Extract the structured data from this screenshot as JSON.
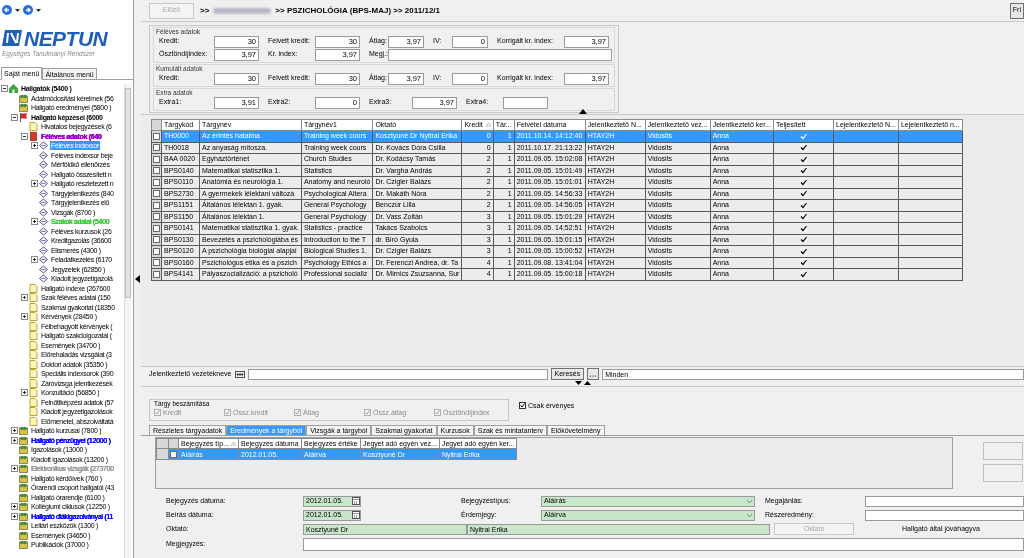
{
  "logo": {
    "name": "NEPTUN",
    "subtitle": "Egységes Tanulmányi Rendszer"
  },
  "menu_tabs": [
    {
      "label": "Saját menü",
      "selected": true
    },
    {
      "label": "Általános menü",
      "selected": false
    }
  ],
  "tree": [
    {
      "label": "Hallgatók (5400 )",
      "kind": "home",
      "bold": true,
      "expanded": true,
      "selected": false,
      "children": [
        {
          "label": "Adatmódosítási kérelmek (56",
          "kind": "group",
          "selected": false
        },
        {
          "label": "Hallgató eredményei (5800 )",
          "kind": "group",
          "selected": false
        },
        {
          "label": "Hallgató képzései (6000",
          "kind": "flag",
          "bold": true,
          "expanded": true,
          "selected": false,
          "children": [
            {
              "label": "Hivatalos bejegyzések (6",
              "kind": "page",
              "selected": false
            },
            {
              "label": "Féléves adatok (640",
              "kind": "book",
              "bold": true,
              "color": "#9900cc",
              "expanded": true,
              "selected": false,
              "children": [
                {
                  "label": "Féléves indexsor",
                  "kind": "form",
                  "expanded": false,
                  "selected": true
                },
                {
                  "label": "Féléves indexsor beje",
                  "kind": "form",
                  "selected": false
                },
                {
                  "label": "Mérföldkő ellenőrzés",
                  "kind": "form",
                  "selected": false
                },
                {
                  "label": "Hallgató összesített n",
                  "kind": "form",
                  "selected": false
                },
                {
                  "label": "Hallgató részletezett n",
                  "kind": "form",
                  "expanded": false,
                  "selected": false
                },
                {
                  "label": "Tárgyjelentkezés (840",
                  "kind": "form",
                  "selected": false
                },
                {
                  "label": "Tárgyjelentkezés elő",
                  "kind": "form",
                  "selected": false
                },
                {
                  "label": "Vizsgák (8700 )",
                  "kind": "form",
                  "selected": false
                },
                {
                  "label": "Szakok adatai (5400",
                  "kind": "form",
                  "color": "#33cc33",
                  "expanded": false,
                  "selected": false
                },
                {
                  "label": "Féléves kurzusok (26",
                  "kind": "form",
                  "selected": false
                },
                {
                  "label": "Kreditgazolás (36600",
                  "kind": "form",
                  "selected": false
                },
                {
                  "label": "Elismerés (4300 )",
                  "kind": "form",
                  "selected": false
                },
                {
                  "label": "Feladatkezelés (6170",
                  "kind": "form",
                  "expanded": false,
                  "selected": false
                },
                {
                  "label": "Jegyzetek (62850 )",
                  "kind": "form",
                  "selected": false
                },
                {
                  "label": "Kiadott jegyzetigazolá",
                  "kind": "form",
                  "selected": false
                }
              ]
            },
            {
              "label": "Hallgató indexe (267600",
              "kind": "page",
              "selected": false
            },
            {
              "label": "Szak féléves adatai (150",
              "kind": "page",
              "expanded": false,
              "selected": false
            },
            {
              "label": "Szakmai gyakorlat (18350",
              "kind": "page",
              "selected": false
            },
            {
              "label": "Kérvények (28450 )",
              "kind": "page",
              "expanded": false,
              "selected": false
            },
            {
              "label": "Félbehagyott kérvények (",
              "kind": "page",
              "selected": false
            },
            {
              "label": "Hallgató szakdolgozatai (",
              "kind": "page",
              "selected": false
            },
            {
              "label": "Események (34700 )",
              "kind": "page",
              "selected": false
            },
            {
              "label": "Előrehaladás vizsgálat (3",
              "kind": "page",
              "selected": false
            },
            {
              "label": "Doktori adatok (35350 )",
              "kind": "page",
              "selected": false
            },
            {
              "label": "Speciális indexsorok (390",
              "kind": "page",
              "selected": false
            },
            {
              "label": "Záróvizsga jelentkezések",
              "kind": "page",
              "selected": false
            },
            {
              "label": "Konzultáció (56850 )",
              "kind": "page",
              "expanded": false,
              "selected": false
            },
            {
              "label": "Felnőttképzési adatok (57",
              "kind": "page",
              "selected": false
            },
            {
              "label": "Kiadott jegyzetigazolások",
              "kind": "page",
              "selected": false
            },
            {
              "label": "Előmenetel, abszolváltatá",
              "kind": "page",
              "selected": false
            }
          ]
        },
        {
          "label": "Hallgató kurzusai (7800 )",
          "kind": "group",
          "expanded": false,
          "selected": false
        },
        {
          "label": "Hallgató pénzügyei (12000 )",
          "kind": "group",
          "color": "#0000ff",
          "expanded": false,
          "selected": false
        },
        {
          "label": "Igazolások (13000 )",
          "kind": "group",
          "selected": false
        },
        {
          "label": "Kiadott igazolások (13200 )",
          "kind": "group",
          "selected": false
        },
        {
          "label": "Elektronikus vizsgák (273700",
          "kind": "group",
          "color": "#999999",
          "expanded": false,
          "selected": false
        },
        {
          "label": "Hallgató kérdőívek (760 )",
          "kind": "group",
          "selected": false
        },
        {
          "label": "Órarendi csoport hallgatói (43",
          "kind": "group",
          "selected": false
        },
        {
          "label": "Hallgató órarendje (6100 )",
          "kind": "group",
          "selected": false
        },
        {
          "label": "Kollégiumi ciklusok (12250 )",
          "kind": "group",
          "expanded": false,
          "selected": false
        },
        {
          "label": "Hallgató diákigazolványai (11",
          "kind": "group",
          "color": "#0000ff",
          "expanded": false,
          "selected": false
        },
        {
          "label": "Leltári eszközök (1300 )",
          "kind": "group",
          "selected": false
        },
        {
          "label": "Események (34650 )",
          "kind": "group",
          "selected": false
        },
        {
          "label": "Publikációk (37000 )",
          "kind": "group",
          "selected": false
        }
      ]
    }
  ],
  "header": {
    "back_button": {
      "label": "Előző",
      "disabled": true
    },
    "path_start": ">>",
    "path": ">> PSZICHOLÓGIA (BPS-MAJ) >> 2011/12/1",
    "corner_button": "Fri"
  },
  "summary": [
    {
      "legend": "Féléves adatok",
      "rows": [
        {
          "kind": "standard",
          "fields": [
            {
              "label": "Kredit:",
              "value": "30"
            },
            {
              "label": "Felvett kredit:",
              "value": "30"
            },
            {
              "label": "Átlag:",
              "value": "3,97"
            },
            {
              "label": "IV:",
              "value": "0"
            },
            {
              "label": "Korrigált kr. index:",
              "value": "3,97"
            }
          ]
        },
        {
          "kind": "notes",
          "fields": [
            {
              "label": "Ösztöndíjindex:",
              "value": "3,97"
            },
            {
              "label": "Kr. index:",
              "value": "3,97"
            },
            {
              "label": "Megj.:"
            }
          ]
        }
      ]
    },
    {
      "legend": "Kumulált adatok",
      "rows": [
        {
          "kind": "standard",
          "fields": [
            {
              "label": "Kredit:",
              "value": "30"
            },
            {
              "label": "Felvett kredit:",
              "value": "30"
            },
            {
              "label": "Átlag:",
              "value": "3,97"
            },
            {
              "label": "IV:",
              "value": "0"
            },
            {
              "label": "Korrigált kr. index:",
              "value": "3,97"
            }
          ]
        }
      ]
    },
    {
      "legend": "Extra adatok",
      "rows": [
        {
          "kind": "extra",
          "fields": [
            {
              "label": "Extra1:",
              "value": "3,91"
            },
            {
              "label": "Extra2:",
              "value": "0"
            },
            {
              "label": "Extra3:",
              "value": "3,97"
            },
            {
              "label": "Extra4:"
            }
          ]
        }
      ]
    }
  ],
  "table": {
    "columns": [
      {
        "label": "Tárgykód"
      },
      {
        "label": "Tárgynév"
      },
      {
        "label": "Tárgynév1"
      },
      {
        "label": "Oktató"
      },
      {
        "label": "Kredit",
        "sorted": true
      },
      {
        "label": "Tár..."
      },
      {
        "label": "Felvétel dátuma"
      },
      {
        "label": "Jelentkeztető N..."
      },
      {
        "label": "Jelentkeztető vez..."
      },
      {
        "label": "Jelentkeztető ker..."
      },
      {
        "label": "Teljesített"
      },
      {
        "label": "Lejelentkeztető N..."
      },
      {
        "label": "Lejelentkeztető n..."
      }
    ],
    "rows": [
      {
        "selected": true,
        "checked": false,
        "completed": true,
        "cells": [
          "TH0000",
          "Az érintés hatalma",
          "Training week cours",
          "Kosztyuné Dr Nyitrai Erika",
          "0",
          "1",
          "2011.10.14. 14:12:40",
          "HTAY2H",
          "Vidosits",
          "Anna"
        ]
      },
      {
        "selected": false,
        "checked": false,
        "completed": true,
        "cells": [
          "TH0018",
          "Az anyaság mítosza.",
          "Training week cours",
          "Dr. Kovács Dóra Csilla",
          "0",
          "1",
          "2011.10.17. 21:13:22",
          "HTAY2H",
          "Vidosits",
          "Anna"
        ]
      },
      {
        "selected": false,
        "checked": false,
        "completed": true,
        "cells": [
          "BAA 0020",
          "Egyháztörténet",
          "Church Studies",
          "Dr. Kodácsy Tamás",
          "2",
          "1",
          "2011.09.05. 15:02:08",
          "HTAY2H",
          "Vidosits",
          "Anna"
        ]
      },
      {
        "selected": false,
        "checked": false,
        "completed": true,
        "cells": [
          "BPS0140",
          "Matematikai statisztika 1.",
          "Statistics",
          "Dr. Vargha András",
          "2",
          "1",
          "2011.09.05. 15:01:49",
          "HTAY2H",
          "Vidosits",
          "Anna"
        ]
      },
      {
        "selected": false,
        "checked": false,
        "completed": true,
        "cells": [
          "BPS0110",
          "Anatómia és neurológia 1.",
          "Anatomy and neuroló",
          "Dr. Czigler Balázs",
          "2",
          "1",
          "2011.09.05. 15:01:01",
          "HTAY2H",
          "Vidosits",
          "Anna"
        ]
      },
      {
        "selected": false,
        "checked": false,
        "completed": true,
        "cells": [
          "BPS2730",
          "A gyermekek lélektani változá",
          "Psychological Altera",
          "Dr. Makáth Nóra",
          "2",
          "1",
          "2011.09.05. 14:56:33",
          "HTAY2H",
          "Vidosits",
          "Anna"
        ]
      },
      {
        "selected": false,
        "checked": false,
        "completed": true,
        "cells": [
          "BPS1151",
          "Általános lélektan 1. gyak.",
          "General Psychology",
          "Benczúr Lilla",
          "2",
          "1",
          "2011.09.05. 14:56:05",
          "HTAY2H",
          "Vidosits",
          "Anna"
        ]
      },
      {
        "selected": false,
        "checked": false,
        "completed": true,
        "cells": [
          "BPS1150",
          "Általános lélektan 1.",
          "General Psychology",
          "Dr. Vass Zoltán",
          "3",
          "1",
          "2011.09.05. 15:01:29",
          "HTAY2H",
          "Vidosits",
          "Anna"
        ]
      },
      {
        "selected": false,
        "checked": false,
        "completed": true,
        "cells": [
          "BPS0141",
          "Matematikai statisztika 1. gyak.",
          "Statistics - practice",
          "Takács Szabolcs",
          "3",
          "1",
          "2011.09.05. 14:52:51",
          "HTAY2H",
          "Vidosits",
          "Anna"
        ]
      },
      {
        "selected": false,
        "checked": false,
        "completed": true,
        "cells": [
          "BPS0130",
          "Bevezetés a pszichológiába és",
          "Introduction to the T",
          "dr. Bíró Gyula",
          "3",
          "1",
          "2011.09.05. 15:01:15",
          "HTAY2H",
          "Vidosits",
          "Anna"
        ]
      },
      {
        "selected": false,
        "checked": false,
        "completed": true,
        "cells": [
          "BPS0120",
          "A pszichológia biológiai alapjai",
          "Biological Studies 1.",
          "Dr. Czigler Balázs",
          "3",
          "1",
          "2011.09.05. 15:00:52",
          "HTAY2H",
          "Vidosits",
          "Anna"
        ]
      },
      {
        "selected": false,
        "checked": false,
        "completed": true,
        "cells": [
          "BPS0160",
          "Pszichológus etika és a pszich",
          "Psychology Ethics a",
          "Dr. Ferenczi Andrea, dr. Ta",
          "4",
          "1",
          "2011.09.08. 13:41:04",
          "HTAY2H",
          "Vidosits",
          "Anna"
        ]
      },
      {
        "selected": false,
        "checked": false,
        "completed": true,
        "cells": [
          "BPS4141",
          "Pályaszocializáció: a pszicholó",
          "Professional socializ",
          "Dr. Mirnics Zsuzsanna, Sur",
          "4",
          "1",
          "2011.09.05. 15:00:18",
          "HTAY2H",
          "Vidosits",
          "Anna"
        ]
      }
    ]
  },
  "search": {
    "label": "Jelentkeztető vezetékneve",
    "button": "Keresés",
    "filter": "Minden"
  },
  "subject_credit": {
    "legend": "Tárgy beszámítása",
    "options": [
      {
        "label": "Kredit",
        "checked": true,
        "disabled": true
      },
      {
        "label": "Össz.kredit",
        "checked": true,
        "disabled": true
      },
      {
        "label": "Átlag",
        "checked": true,
        "disabled": true
      },
      {
        "label": "Össz.átlag",
        "checked": true,
        "disabled": true
      },
      {
        "label": "Ösztöndíjindex",
        "checked": true,
        "disabled": true
      },
      {
        "label": "Csak érvényes",
        "checked": true,
        "disabled": false
      }
    ]
  },
  "detail_tabs": [
    {
      "label": "Részletes tárgyadatok",
      "selected": false
    },
    {
      "label": "Eredmények a tárgyból",
      "selected": true
    },
    {
      "label": "Vizsgák a tárgyból",
      "selected": false
    },
    {
      "label": "Szakmai gyakorlat",
      "selected": false
    },
    {
      "label": "Kurzusok",
      "selected": false
    },
    {
      "label": "Szak és mintatanterv",
      "selected": false
    },
    {
      "label": "Előkövetelmény",
      "selected": false
    }
  ],
  "entries": {
    "columns": [
      {
        "label": "Bejegyzés típ...",
        "sorted": true
      },
      {
        "label": "Bejegyzés dátuma"
      },
      {
        "label": "Bejegyzés értéke"
      },
      {
        "label": "Jegyet adó egyén vez..."
      },
      {
        "label": "Jegyet adó egyén ker..."
      }
    ],
    "rows": [
      {
        "selected": true,
        "checked": false,
        "cells": [
          "Aláírás",
          "2012.01.05.",
          "Aláírva",
          "Kosztyuné Dr",
          "Nyitrai Erika"
        ]
      }
    ]
  },
  "entry_form": {
    "entry_date": {
      "label": "Bejegyzés dátuma:",
      "value": "2012.01.05."
    },
    "record_date": {
      "label": "Beírás dátuma:",
      "value": "2012.01.05."
    },
    "entry_type": {
      "label": "Bejegyzéstípus:",
      "value": "Aláírás"
    },
    "grade": {
      "label": "Érdemjegy:",
      "value": "Aláírva"
    },
    "offer": {
      "label": "Megajánlás:"
    },
    "partial": {
      "label": "Részeredmény:"
    },
    "teacher": {
      "label": "Oktató:",
      "last_name": "Kosztyuné Dr",
      "first_name": "Nyitrai Erika",
      "button": "Oktató",
      "button_disabled": true
    },
    "approved_text": "Hallgató által jóváhagyva",
    "note": {
      "label": "Megjegyzés:"
    }
  }
}
